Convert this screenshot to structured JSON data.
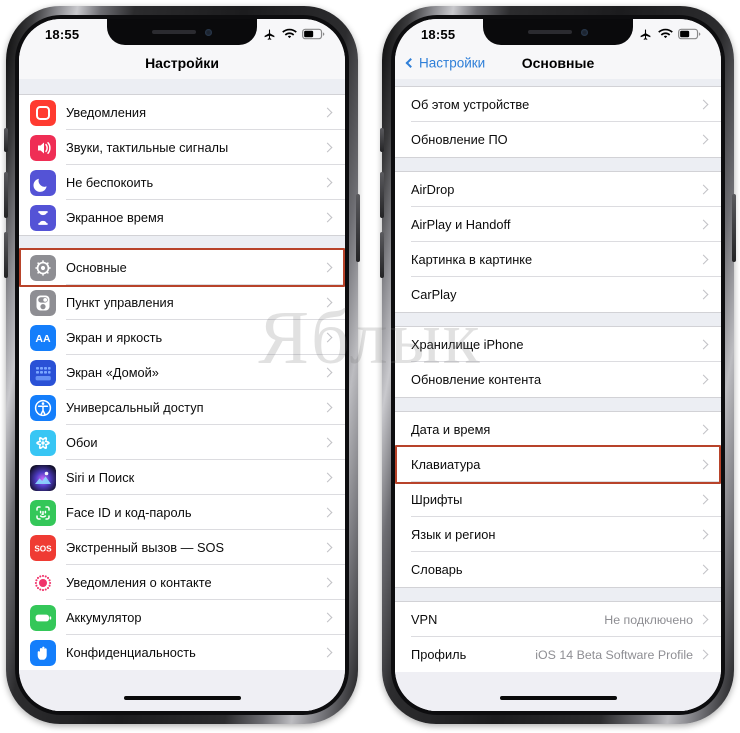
{
  "watermark": {
    "text": "Яблык"
  },
  "left_phone": {
    "status_bar": {
      "time": "18:55",
      "icons": [
        "airplane-mode-icon",
        "wifi-icon",
        "battery-icon"
      ]
    },
    "nav": {
      "title": "Настройки"
    },
    "groups": [
      {
        "rows": [
          {
            "label": "Уведомления",
            "icon": "notifications-icon",
            "icon_color": "#ff3b30",
            "chevron": true
          },
          {
            "label": "Звуки, тактильные сигналы",
            "icon": "sounds-icon",
            "icon_color": "#ef2e55",
            "chevron": true
          },
          {
            "label": "Не беспокоить",
            "icon": "do-not-disturb-icon",
            "icon_color": "#5453d6",
            "chevron": true
          },
          {
            "label": "Экранное время",
            "icon": "screen-time-icon",
            "icon_color": "#5453d6",
            "chevron": true
          }
        ]
      },
      {
        "rows": [
          {
            "label": "Основные",
            "icon": "general-gear-icon",
            "icon_color": "#8e8e93",
            "chevron": true,
            "highlighted": true
          },
          {
            "label": "Пункт управления",
            "icon": "control-center-icon",
            "icon_color": "#8e8e93",
            "chevron": true
          },
          {
            "label": "Экран и яркость",
            "icon": "display-brightness-icon",
            "icon_color": "#147efb",
            "chevron": true
          },
          {
            "label": "Экран «Домой»",
            "icon": "home-screen-icon",
            "icon_color": "#2a51d6",
            "chevron": true
          },
          {
            "label": "Универсальный доступ",
            "icon": "accessibility-icon",
            "icon_color": "#147efb",
            "chevron": true
          },
          {
            "label": "Обои",
            "icon": "wallpaper-icon",
            "icon_color": "#38c6f4",
            "chevron": true
          },
          {
            "label": "Siri и Поиск",
            "icon": "siri-icon",
            "icon_color": "#1b1238",
            "chevron": true
          },
          {
            "label": "Face ID и код-пароль",
            "icon": "face-id-icon",
            "icon_color": "#34c759",
            "chevron": true
          },
          {
            "label": "Экстренный вызов — SOS",
            "icon": "sos-icon",
            "icon_color": "#ef3b33",
            "chevron": true
          },
          {
            "label": "Уведомления о контакте",
            "icon": "exposure-notifications-icon",
            "icon_color": "#ffffff",
            "chevron": true
          },
          {
            "label": "Аккумулятор",
            "icon": "battery-settings-icon",
            "icon_color": "#34c759",
            "chevron": true
          },
          {
            "label": "Конфиденциальность",
            "icon": "privacy-hand-icon",
            "icon_color": "#147efb",
            "chevron": true
          }
        ]
      }
    ]
  },
  "right_phone": {
    "status_bar": {
      "time": "18:55",
      "icons": [
        "airplane-mode-icon",
        "wifi-icon",
        "battery-icon"
      ]
    },
    "nav": {
      "back_label": "Настройки",
      "title": "Основные"
    },
    "groups": [
      {
        "rows": [
          {
            "label": "Об этом устройстве",
            "chevron": true
          },
          {
            "label": "Обновление ПО",
            "chevron": true
          }
        ]
      },
      {
        "rows": [
          {
            "label": "AirDrop",
            "chevron": true
          },
          {
            "label": "AirPlay и Handoff",
            "chevron": true
          },
          {
            "label": "Картинка в картинке",
            "chevron": true
          },
          {
            "label": "CarPlay",
            "chevron": true
          }
        ]
      },
      {
        "rows": [
          {
            "label": "Хранилище iPhone",
            "chevron": true
          },
          {
            "label": "Обновление контента",
            "chevron": true
          }
        ]
      },
      {
        "rows": [
          {
            "label": "Дата и время",
            "chevron": true
          },
          {
            "label": "Клавиатура",
            "chevron": true,
            "highlighted": true
          },
          {
            "label": "Шрифты",
            "chevron": true
          },
          {
            "label": "Язык и регион",
            "chevron": true
          },
          {
            "label": "Словарь",
            "chevron": true
          }
        ]
      },
      {
        "rows": [
          {
            "label": "VPN",
            "value": "Не подключено",
            "chevron": true
          },
          {
            "label": "Профиль",
            "value": "iOS 14 Beta Software Profile",
            "chevron": true
          }
        ]
      }
    ]
  },
  "colors": {
    "highlight_border": "#b8432a",
    "ios_blue": "#2f7fd8",
    "list_bg": "#efeff4",
    "separator": "#dcdce0",
    "value_text": "#8e8e93"
  }
}
